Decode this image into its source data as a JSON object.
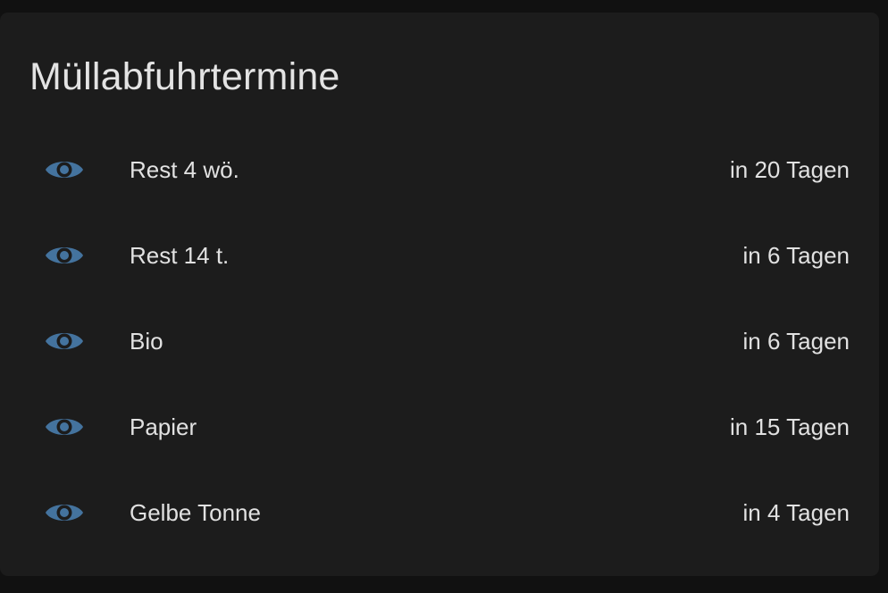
{
  "card": {
    "title": "Müllabfuhrtermine",
    "icon_color": "#44739e",
    "background": "#1c1c1c"
  },
  "entities": [
    {
      "name": "Rest 4 wö.",
      "state": "in 20 Tagen",
      "icon": "eye-icon"
    },
    {
      "name": "Rest 14 t.",
      "state": "in 6 Tagen",
      "icon": "eye-icon"
    },
    {
      "name": "Bio",
      "state": "in 6 Tagen",
      "icon": "eye-icon"
    },
    {
      "name": "Papier",
      "state": "in 15 Tagen",
      "icon": "eye-icon"
    },
    {
      "name": "Gelbe Tonne",
      "state": "in 4 Tagen",
      "icon": "eye-icon"
    }
  ]
}
